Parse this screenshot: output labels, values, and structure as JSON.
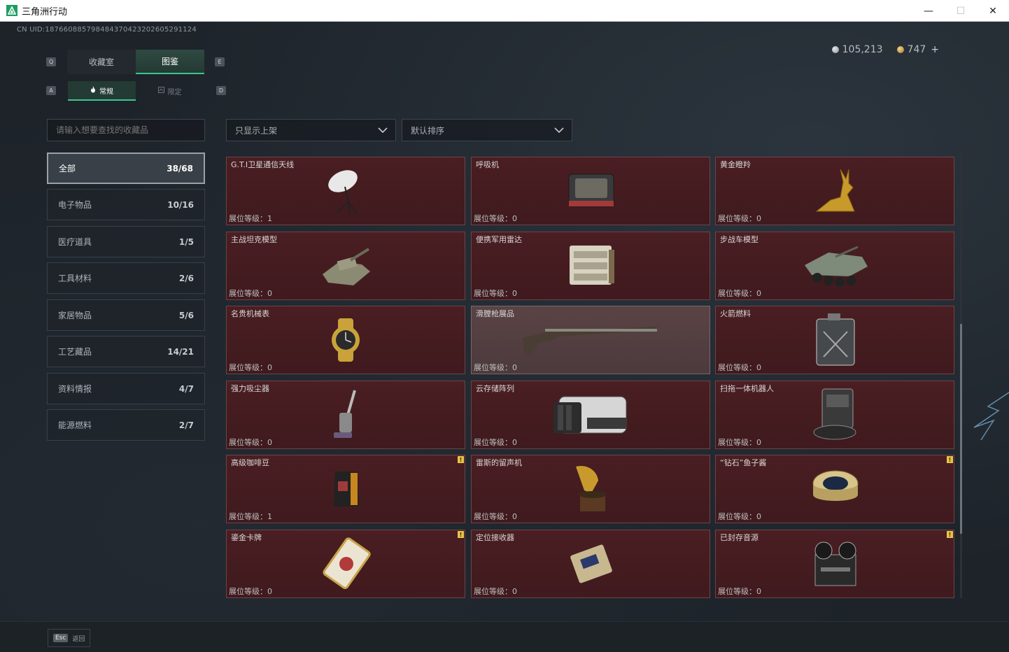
{
  "window": {
    "title": "三角洲行动",
    "minimize": "—",
    "maximize": "☐",
    "close": "✕"
  },
  "header": {
    "uid": "CN UID:18766088579848437042320260529112​4",
    "silver": "105,213",
    "gold": "747",
    "plus": "+"
  },
  "keys": {
    "q": "Q",
    "e": "E",
    "a": "A",
    "d": "D"
  },
  "tabs": {
    "collection": "收藏室",
    "codex": "图鉴"
  },
  "subtabs": {
    "normal": "常规",
    "limited": "限定"
  },
  "search": {
    "placeholder": "请输入想要查找的收藏品"
  },
  "filters": {
    "shelf": "只显示上架",
    "sort": "默认排序"
  },
  "categories": [
    {
      "label": "全部",
      "count": "38/68"
    },
    {
      "label": "电子物品",
      "count": "10/16"
    },
    {
      "label": "医疗道具",
      "count": "1/5"
    },
    {
      "label": "工具材料",
      "count": "2/6"
    },
    {
      "label": "家居物品",
      "count": "5/6"
    },
    {
      "label": "工艺藏品",
      "count": "14/21"
    },
    {
      "label": "资料情报",
      "count": "4/7"
    },
    {
      "label": "能源燃料",
      "count": "2/7"
    }
  ],
  "items": [
    {
      "name": "G.T.I卫星通信天线",
      "level": "展位等级：1",
      "icon": "satellite-dish-icon"
    },
    {
      "name": "呼吸机",
      "level": "展位等级：0",
      "icon": "ventilator-icon"
    },
    {
      "name": "黄金瞪羚",
      "level": "展位等级：0",
      "icon": "golden-gazelle-icon"
    },
    {
      "name": "主战坦克模型",
      "level": "展位等级：0",
      "icon": "tank-model-icon"
    },
    {
      "name": "便携军用雷达",
      "level": "展位等级：0",
      "icon": "radar-icon"
    },
    {
      "name": "步战车模型",
      "level": "展位等级：0",
      "icon": "ifv-model-icon"
    },
    {
      "name": "名贵机械表",
      "level": "展位等级：0",
      "icon": "watch-icon"
    },
    {
      "name": "滑膛枪展品",
      "level": "展位等级：0",
      "icon": "musket-icon"
    },
    {
      "name": "火箭燃料",
      "level": "展位等级：0",
      "icon": "fuel-can-icon"
    },
    {
      "name": "强力吸尘器",
      "level": "展位等级：0",
      "icon": "vacuum-icon"
    },
    {
      "name": "云存储阵列",
      "level": "展位等级：0",
      "icon": "storage-array-icon"
    },
    {
      "name": "扫拖一体机器人",
      "level": "展位等级：0",
      "icon": "robot-vacuum-icon"
    },
    {
      "name": "高级咖啡豆",
      "level": "展位等级：1",
      "icon": "coffee-bag-icon"
    },
    {
      "name": "雷斯的留声机",
      "level": "展位等级：0",
      "icon": "gramophone-icon"
    },
    {
      "name": "“钻石”鱼子酱",
      "level": "展位等级：0",
      "icon": "caviar-tin-icon"
    },
    {
      "name": "鎏金卡牌",
      "level": "展位等级：0",
      "icon": "gilded-card-icon"
    },
    {
      "name": "定位接收器",
      "level": "展位等级：0",
      "icon": "gps-receiver-icon"
    },
    {
      "name": "已封存音源",
      "level": "展位等级：0",
      "icon": "reel-recorder-icon"
    }
  ],
  "badges": {
    "warn": "!"
  },
  "bottom": {
    "esc": "Esc",
    "back": "返回"
  },
  "colors": {
    "accent": "#3fc58f",
    "card": "#4a1e22",
    "card_selected": "#5a4345",
    "badge": "#e7c24a"
  }
}
